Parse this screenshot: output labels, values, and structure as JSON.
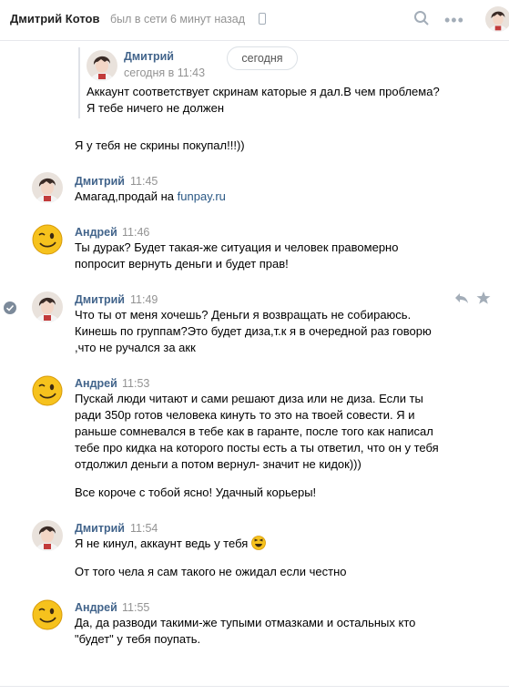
{
  "header": {
    "name": "Дмитрий Котов",
    "status": "был в сети 6 минут назад",
    "more": "•••"
  },
  "date_badge": "сегодня",
  "forwarded": {
    "author": "Дмитрий",
    "time": "сегодня в 11:43",
    "lines": [
      "Аккаунт соответствует скринам каторые я дал.В чем проблема?",
      "Я тебе ничего не должен"
    ]
  },
  "standalone_line": "Я у тебя не скрины покупал!!!))",
  "messages": [
    {
      "author": "Дмитрий",
      "time": "11:45",
      "lines": [
        {
          "text": "Амагад,продай на ",
          "link": "funpay.ru"
        }
      ]
    },
    {
      "author": "Андрей",
      "time": "11:46",
      "lines": [
        {
          "text": "Ты дурак? Будет такая-же ситуация и человек правомерно"
        },
        {
          "text": "попросит вернуть деньги и будет прав!"
        }
      ]
    },
    {
      "author": "Дмитрий",
      "time": "11:49",
      "lines": [
        {
          "text": "Что ты от меня хочешь? Деньги я возвращать не собираюсь."
        },
        {
          "text": "Кинешь по группам?Это будет диза,т.к я в очередной раз говорю"
        },
        {
          "text": ",что не ручался за акк"
        }
      ]
    },
    {
      "author": "Андрей",
      "time": "11:53",
      "lines": [
        {
          "text": "Пускай люди читают и сами решают диза или не диза. Если ты"
        },
        {
          "text": "ради 350р готов человека кинуть то это на твоей совести. Я и"
        },
        {
          "text": "раньше сомневался в тебе как в гаранте, после того как написал"
        },
        {
          "text": "тебе про кидка на которого посты есть а ты ответил, что он у тебя"
        },
        {
          "text": "отдолжил деньги а потом вернул- значит не кидок)))"
        }
      ],
      "extra": "Все короче с тобой ясно! Удачный корьеры!"
    },
    {
      "author": "Дмитрий",
      "time": "11:54",
      "lines": [
        {
          "text": "Я не кинул, аккаунт ведь у тебя"
        }
      ],
      "emoji": "laughing-emoji",
      "extra": "От того чела я сам такого не ожидал если честно"
    },
    {
      "author": "Андрей",
      "time": "11:55",
      "lines": [
        {
          "text": "Да, да разводи такими-же тупыми отмазками и остальных кто"
        },
        {
          "text": "\"будет\" у тебя поупать."
        }
      ]
    }
  ],
  "icons": [
    "search-icon",
    "more-icon",
    "phone-icon",
    "reply-icon",
    "star-icon",
    "check-icon"
  ],
  "colors": {
    "author": "#42648b",
    "time": "#939393",
    "link": "#2a5885",
    "icon": "#a3adb8"
  }
}
